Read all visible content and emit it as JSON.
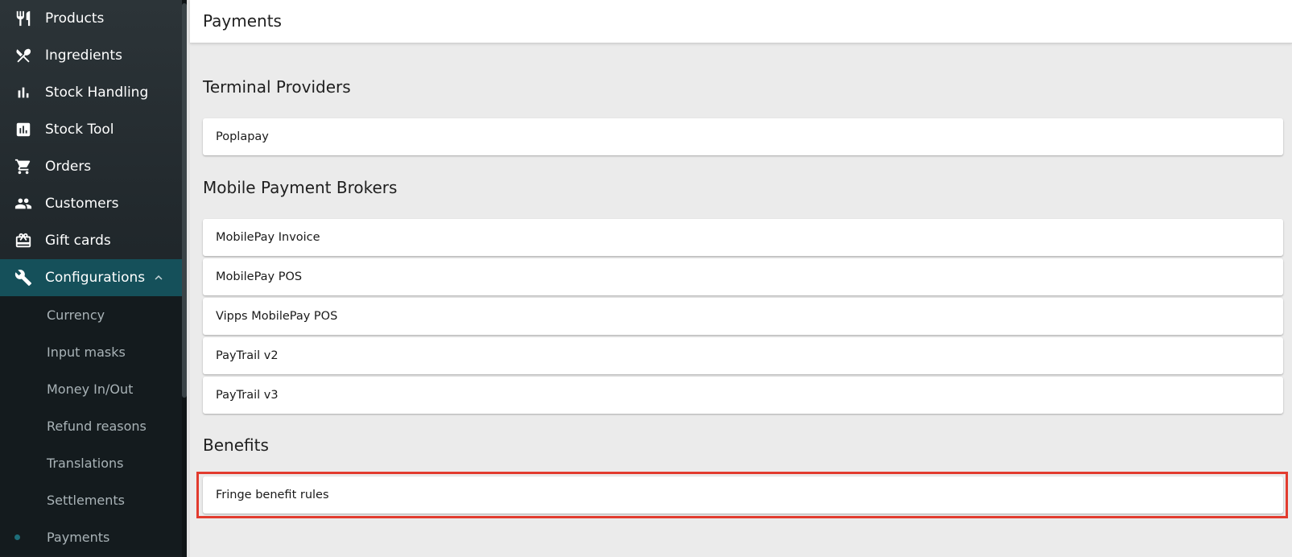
{
  "sidebar": {
    "items": [
      {
        "label": "Products",
        "icon": "cutlery-icon"
      },
      {
        "label": "Ingredients",
        "icon": "utensils-cross-icon"
      },
      {
        "label": "Stock Handling",
        "icon": "bar-chart-icon"
      },
      {
        "label": "Stock Tool",
        "icon": "chart-box-icon"
      },
      {
        "label": "Orders",
        "icon": "cart-icon"
      },
      {
        "label": "Customers",
        "icon": "people-icon"
      },
      {
        "label": "Gift cards",
        "icon": "gift-card-icon"
      },
      {
        "label": "Configurations",
        "icon": "wrench-icon"
      }
    ],
    "sub_items": [
      {
        "label": "Currency"
      },
      {
        "label": "Input masks"
      },
      {
        "label": "Money In/Out"
      },
      {
        "label": "Refund reasons"
      },
      {
        "label": "Translations"
      },
      {
        "label": "Settlements"
      },
      {
        "label": "Payments"
      }
    ],
    "colors": {
      "active": "#15505a",
      "dot": "#1e6e7a"
    }
  },
  "header": {
    "title": "Payments"
  },
  "sections": {
    "terminal": {
      "title": "Terminal Providers",
      "items": [
        "Poplapay"
      ]
    },
    "mobile": {
      "title": "Mobile Payment Brokers",
      "items": [
        "MobilePay Invoice",
        "MobilePay POS",
        "Vipps MobilePay POS",
        "PayTrail v2",
        "PayTrail v3"
      ]
    },
    "benefits": {
      "title": "Benefits",
      "items": [
        "Fringe benefit rules"
      ]
    }
  },
  "highlight_color": "#e23b2e"
}
